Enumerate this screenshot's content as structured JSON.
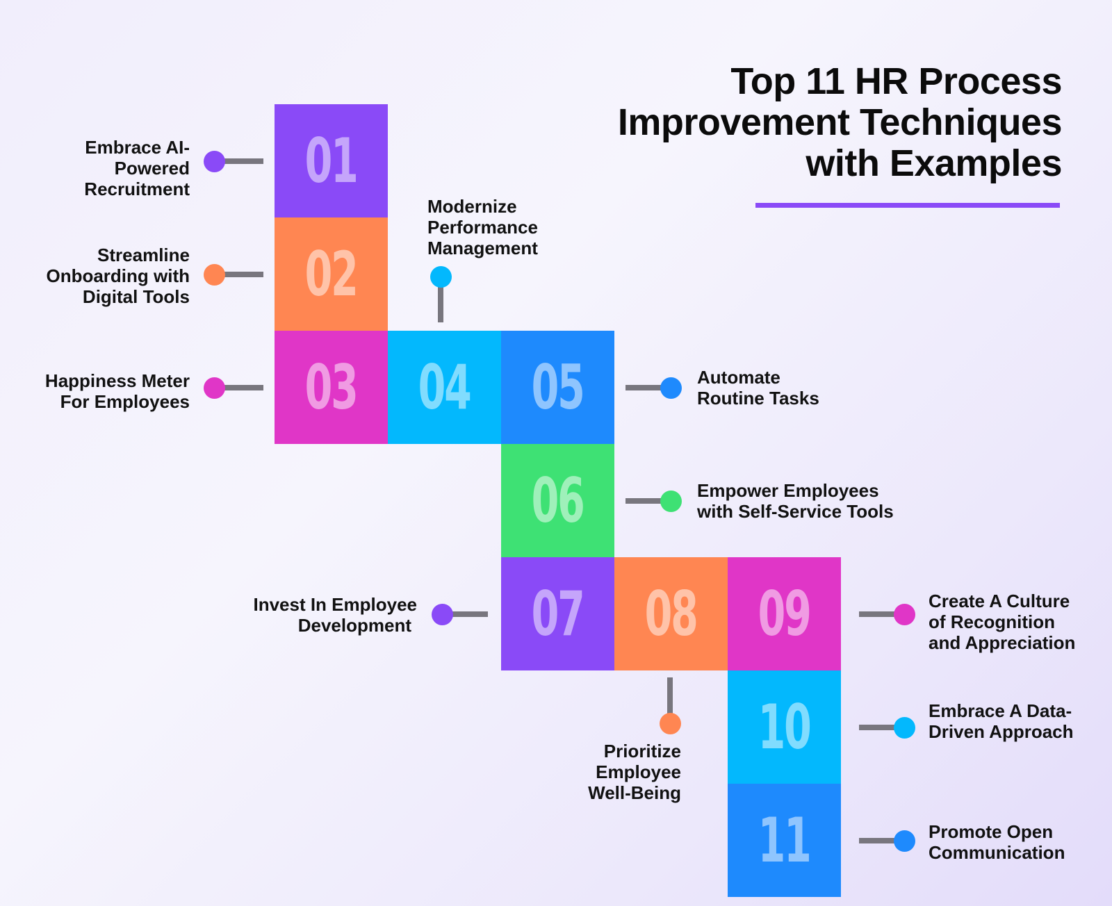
{
  "title": {
    "lines": [
      "Top 11 HR Process",
      "Improvement Techniques",
      "with Examples"
    ],
    "underline_color": "#8a4af7"
  },
  "steps": [
    {
      "number": "01",
      "lines": [
        "Embrace AI-",
        "Powered",
        "Recruitment"
      ],
      "color": "#8a4af7"
    },
    {
      "number": "02",
      "lines": [
        "Streamline",
        "Onboarding with",
        "Digital Tools"
      ],
      "color": "#ff8652"
    },
    {
      "number": "03",
      "lines": [
        "Happiness Meter",
        "For Employees"
      ],
      "color": "#e036c7"
    },
    {
      "number": "04",
      "lines": [
        "Modernize",
        "Performance",
        "Management"
      ],
      "color": "#03b8fd"
    },
    {
      "number": "05",
      "lines": [
        "Automate",
        "Routine Tasks"
      ],
      "color": "#1e8afd"
    },
    {
      "number": "06",
      "lines": [
        "Empower Employees",
        "with Self-Service Tools"
      ],
      "color": "#3ee174"
    },
    {
      "number": "07",
      "lines": [
        "Invest In Employee",
        "Development"
      ],
      "color": "#8a4af7"
    },
    {
      "number": "08",
      "lines": [
        "Prioritize",
        "Employee",
        "Well-Being"
      ],
      "color": "#ff8652"
    },
    {
      "number": "09",
      "lines": [
        "Create A Culture",
        "of Recognition",
        "and Appreciation"
      ],
      "color": "#e036c7"
    },
    {
      "number": "10",
      "lines": [
        "Embrace A Data-",
        "Driven Approach"
      ],
      "color": "#03b8fd"
    },
    {
      "number": "11",
      "lines": [
        "Promote Open",
        "Communication"
      ],
      "color": "#1e8afd"
    }
  ],
  "connector_color": "#78767e"
}
